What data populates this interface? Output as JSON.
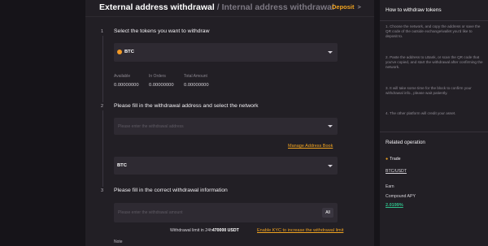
{
  "header": {
    "active_tab": "External address withdrawal",
    "separator": "/",
    "inactive_tab": "Internal address withdrawal",
    "deposit_label": "Deposit",
    "deposit_chevron": ">"
  },
  "step1": {
    "number": "1",
    "title": "Select the tokens you want to withdraw",
    "selected_token": "BTC",
    "balances": [
      {
        "label": "Available",
        "value": "0.00000000"
      },
      {
        "label": "In Orders",
        "value": "0.00000000"
      },
      {
        "label": "Total Amount",
        "value": "0.00000000"
      }
    ]
  },
  "step2": {
    "number": "2",
    "title": "Please fill in the withdrawal address and select the network",
    "address_placeholder": "Please enter the withdrawal address",
    "manage_link": "Manage Address Book",
    "network": "BTC"
  },
  "step3": {
    "number": "3",
    "title": "Please fill in the correct withdrawal information",
    "amount_placeholder": "Please enter the withdrawal amount",
    "all_button": "All",
    "limit_prefix": "Withdrawal limit in 24h",
    "limit_value": "470000",
    "limit_unit": "USDT",
    "kyc_link": "Enable KYC to increase the withdrawal limit",
    "note_label": "Note"
  },
  "sidebar": {
    "how_title": "How to withdraw tokens",
    "steps": [
      "1. Choose the network, and copy the address or save the QR code of the outside exchange/wallet you'd like to deposit to.",
      "2. Paste the address to LBank, or scan the QR code that you've copied, and start the withdrawal after confirming the network.",
      "3. It will take some time for the block to confirm your withdrawal info., please wait patiently.",
      "4. The other platform will credit your asset."
    ],
    "related_title": "Related operation",
    "trade_label": "Trade",
    "trade_pair": "BTC/USDT",
    "earn_label": "Earn",
    "apy_label": "Compound APY",
    "apy_value": "2.0199%"
  },
  "colors": {
    "accent": "#f0a320",
    "positive": "#2fbf8a",
    "panel": "#221f25",
    "background": "#161419"
  },
  "icons": {
    "coin": "btc-coin-icon",
    "trade": "fire-icon",
    "select": "chevron-down-icon"
  }
}
